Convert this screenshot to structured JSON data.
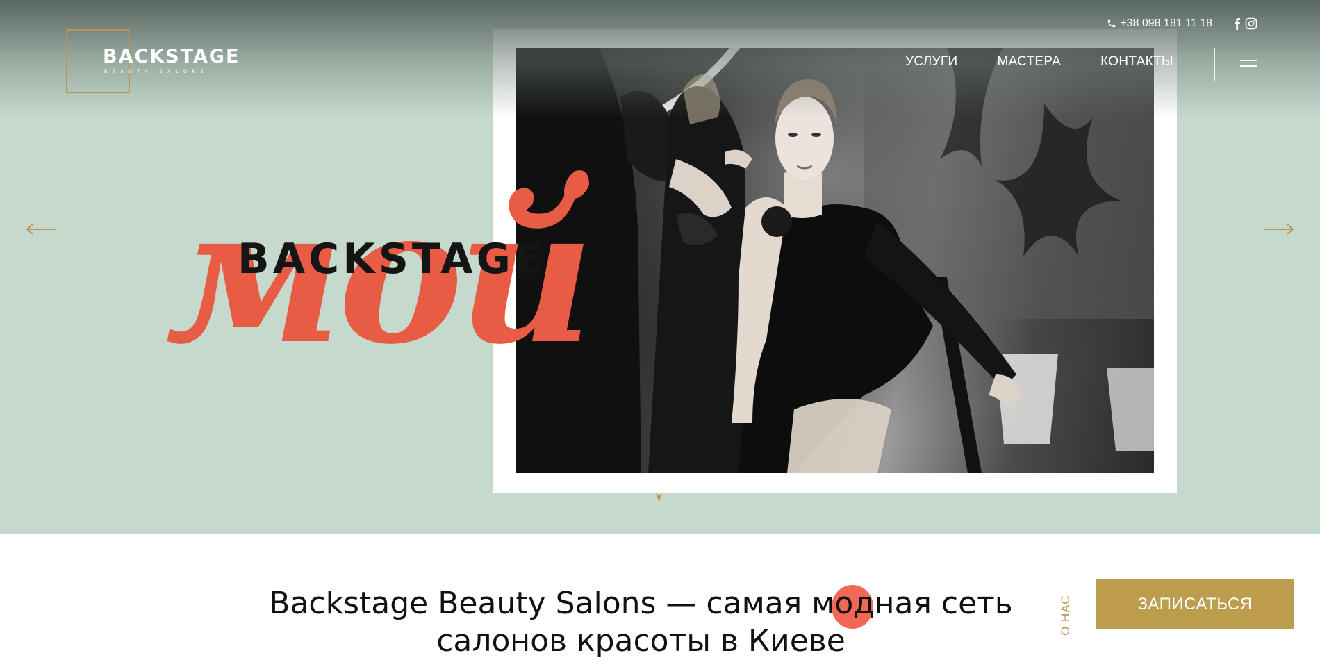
{
  "brand": {
    "title": "BACKSTAGE",
    "subtitle": "BEAUTY SALONS",
    "accent_gold": "#b9974f",
    "accent_coral": "#e85b45",
    "hero_bg": "#c5d9cd"
  },
  "topbar": {
    "phone": "+38 098 181 11 18",
    "social_icons": [
      "facebook-icon",
      "instagram-icon"
    ]
  },
  "nav": {
    "items": [
      {
        "label": "УСЛУГИ"
      },
      {
        "label": "МАСТЕРА"
      },
      {
        "label": "КОНТАКТЫ"
      }
    ],
    "menu_icon": "hamburger-icon"
  },
  "hero": {
    "brush_word": "мой",
    "word": "BACKSTAGE",
    "photo_alt": "black-and-white salon photo"
  },
  "intro": {
    "line1": "Backstage Beauty Salons — самая модная сеть",
    "line2": "салонов красоты в Киеве"
  },
  "about_label": "О НАС",
  "cta": {
    "label": "ЗАПИСАТЬСЯ"
  }
}
